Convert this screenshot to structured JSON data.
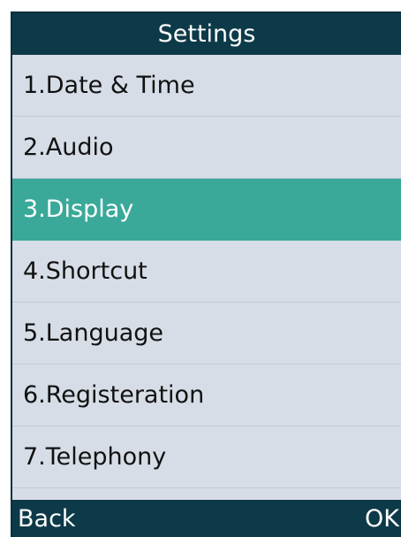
{
  "title": "Settings",
  "menu": {
    "items": [
      {
        "label": "1.Date & Time"
      },
      {
        "label": "2.Audio"
      },
      {
        "label": "3.Display",
        "selected": true
      },
      {
        "label": "4.Shortcut"
      },
      {
        "label": "5.Language"
      },
      {
        "label": "6.Registeration"
      },
      {
        "label": "7.Telephony"
      }
    ]
  },
  "softkeys": {
    "left": "Back",
    "right": "OK"
  },
  "colors": {
    "header_bg": "#0d3a48",
    "list_bg": "#d6dde6",
    "selected_bg": "#3aa99a"
  }
}
